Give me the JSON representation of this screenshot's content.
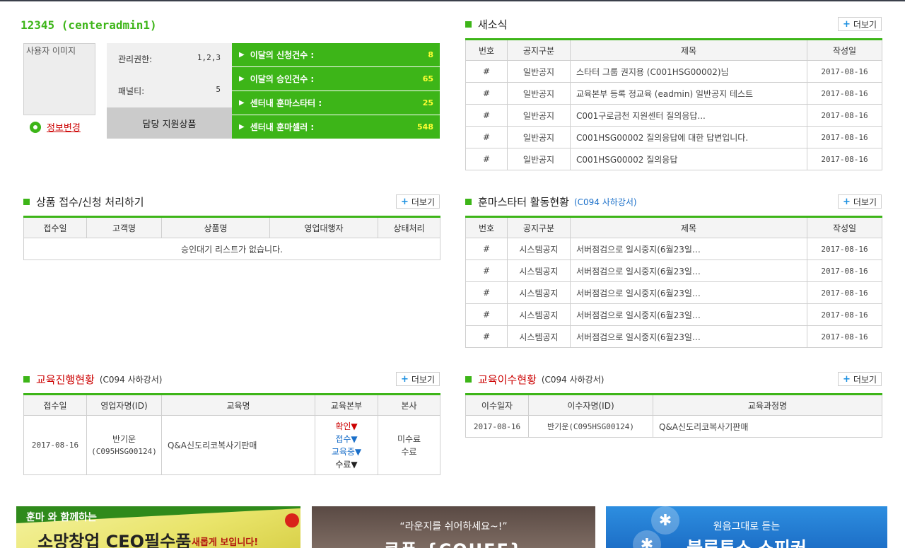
{
  "profile": {
    "user_title": "12345 (centeradmin1)",
    "image_placeholder": "사용자 이미지",
    "edit_label": "정보변경",
    "permission_label": "관리권한:",
    "permission_value": "1,2,3",
    "penalty_label": "패널티:",
    "penalty_value": "5",
    "support_label": "담당 지원상품",
    "stats": [
      {
        "label": "이달의 신청건수 :",
        "value": "8"
      },
      {
        "label": "이달의 승인건수 :",
        "value": "65"
      },
      {
        "label": "센터내 훈마스타터 :",
        "value": "25"
      },
      {
        "label": "센터내 훈마셀러 :",
        "value": "548"
      }
    ]
  },
  "more_label": "더보기",
  "news": {
    "title": "새소식",
    "columns": [
      "번호",
      "공지구분",
      "제목",
      "작성일"
    ],
    "rows": [
      {
        "no": "#",
        "type": "일반공지",
        "title": "스타터 그룹 권지용 (C001HSG00002)님",
        "date": "2017-08-16"
      },
      {
        "no": "#",
        "type": "일반공지",
        "title": "교육본부 등록 정교육 (eadmin) 일반공지 테스트",
        "date": "2017-08-16"
      },
      {
        "no": "#",
        "type": "일반공지",
        "title": "C001구로금천 지원센터 질의응답...",
        "date": "2017-08-16"
      },
      {
        "no": "#",
        "type": "일반공지",
        "title": "C001HSG00002 질의응답에 대한 답변입니다.",
        "date": "2017-08-16"
      },
      {
        "no": "#",
        "type": "일반공지",
        "title": "C001HSG00002 질의응답",
        "date": "2017-08-16"
      }
    ]
  },
  "product": {
    "title": "상품 접수/신청 처리하기",
    "columns": [
      "접수일",
      "고객명",
      "상품명",
      "영업대행자",
      "상태처리"
    ],
    "empty_message": "승인대기 리스트가 없습니다."
  },
  "starter": {
    "title": "훈마스타터 활동현황",
    "subtitle": "(C094 사하강서)",
    "columns": [
      "번호",
      "공지구분",
      "제목",
      "작성일"
    ],
    "rows": [
      {
        "no": "#",
        "type": "시스템공지",
        "title": "서버점검으로 일시중지(6월23일…",
        "date": "2017-08-16"
      },
      {
        "no": "#",
        "type": "시스템공지",
        "title": "서버점검으로 일시중지(6월23일…",
        "date": "2017-08-16"
      },
      {
        "no": "#",
        "type": "시스템공지",
        "title": "서버점검으로 일시중지(6월23일…",
        "date": "2017-08-16"
      },
      {
        "no": "#",
        "type": "시스템공지",
        "title": "서버점검으로 일시중지(6월23일…",
        "date": "2017-08-16"
      },
      {
        "no": "#",
        "type": "시스템공지",
        "title": "서버점검으로 일시중지(6월23일…",
        "date": "2017-08-16"
      }
    ]
  },
  "edu_progress": {
    "title": "교육진행현황",
    "subtitle": "(C094 사하강서)",
    "columns": [
      "접수일",
      "영업자명(ID)",
      "교육명",
      "교육본부",
      "본사"
    ],
    "row": {
      "date": "2017-08-16",
      "name": "반기운",
      "id": "(C095HSG00124)",
      "course": "Q&A신도리코복사기판매",
      "hq_status": [
        "확인▼",
        "접수▼",
        "교육중▼",
        "수료▼"
      ],
      "head_status": [
        "미수료",
        "수료"
      ]
    }
  },
  "edu_complete": {
    "title": "교육이수현황",
    "subtitle": "(C094 사하강서)",
    "columns": [
      "이수일자",
      "이수자명(ID)",
      "교육과정명"
    ],
    "row": {
      "date": "2017-08-16",
      "name": "반기운(C095HSG00124)",
      "course": "Q&A신도리코복사기판매"
    }
  },
  "banners": {
    "b1_line1": "훈마 와 함께하는",
    "b1_line2": "소망창업 CEO필수품",
    "b1_line3": "새롭게 보입니다!",
    "b2_line1": "“라운지를 쉬어하세요~!”",
    "b2_line2": "쿠폰 {COUFF}",
    "b3_line1": "원음그대로 듣는",
    "b3_line2": "블루투스 스피커"
  },
  "colors": {
    "accent": "#3db518",
    "highlight": "#ffff33",
    "alert": "#cc0000",
    "link_blue": "#1a6fc9"
  }
}
